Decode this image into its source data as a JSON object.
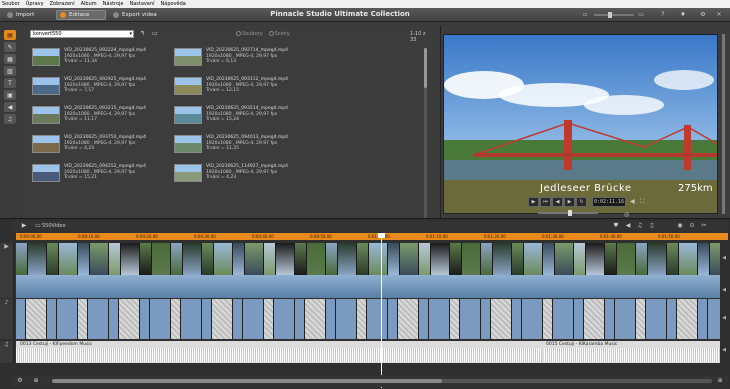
{
  "menu": [
    "Soubor",
    "Úpravy",
    "Zobrazení",
    "Album",
    "Nástroje",
    "Nastavení",
    "Nápověda"
  ],
  "tabs": [
    {
      "label": "Import"
    },
    {
      "label": "Editace"
    },
    {
      "label": "Export videa"
    }
  ],
  "app_title": "Pinnacle Studio Ultimate Collection",
  "colors": {
    "accent": "#e88a1c",
    "background": "#3a3a3a",
    "video_track": "#6b8fb4"
  },
  "library": {
    "folder": "konvert550",
    "view_options": [
      "Soubory",
      "Scény"
    ],
    "counter": "1-10 z 33",
    "clips": [
      {
        "name": "VID_20230625_092224_mpeg4.mp4",
        "res": "1920x1080 , MPEG-4, 29,97 fps",
        "dur": "Trvání = 11,34"
      },
      {
        "name": "VID_20230625_092714_mpeg4.mp4",
        "res": "1920x1080 , MPEG-4, 29,97 fps",
        "dur": "Trvání = 6,13"
      },
      {
        "name": "VID_20230625_092925_mpeg4.mp4",
        "res": "1920x1080 , MPEG-4, 29,97 fps",
        "dur": "Trvání = 7,17"
      },
      {
        "name": "VID_20230625_093112_mpeg4.mp4",
        "res": "1920x1080 , MPEG-4, 29,97 fps",
        "dur": "Trvání = 12,15"
      },
      {
        "name": "VID_20230625_093215_mpeg4.mp4",
        "res": "1920x1080 , MPEG-4, 29,97 fps",
        "dur": "Trvání = 11,17"
      },
      {
        "name": "VID_20230625_093514_mpeg4.mp4",
        "res": "1920x1080 , MPEG-4, 29,97 fps",
        "dur": "Trvání = 15,24"
      },
      {
        "name": "VID_20230625_093750_mpeg4.mp4",
        "res": "1920x1080 , MPEG-4, 29,97 fps",
        "dur": "Trvání = 4,24"
      },
      {
        "name": "VID_20230625_094013_mpeg4.mp4",
        "res": "1920x1080 , MPEG-4, 29,97 fps",
        "dur": "Trvání = 11,25"
      },
      {
        "name": "VID_20230625_094252_mpeg4.mp4",
        "res": "1920x1080 , MPEG-4, 29,97 fps",
        "dur": "Trvání = 15,21"
      },
      {
        "name": "VID_20230625_114927_mpeg4.mp4",
        "res": "1920x1080 , MPEG-4, 29,97 fps",
        "dur": "Trvání = 4,23"
      }
    ]
  },
  "preview": {
    "caption": "Jedleseer Brücke",
    "distance": "275km",
    "timecode": "0:02:11.16"
  },
  "timeline": {
    "project_name": "550Video",
    "ruler_ticks": [
      "0:00:00.00",
      "0:00:10.00",
      "0:00:20.00",
      "0:00:30.00",
      "0:00:40.00",
      "0:00:50.00",
      "0:01:00.00",
      "0:01:10.00",
      "0:01:20.00",
      "0:01:30.00",
      "0:01:40.00",
      "0:01:50.00"
    ],
    "music1": "0013 Cestuji - KlFpeedom Music",
    "music2": "0015 Cestuji - KlKaramba Music"
  }
}
